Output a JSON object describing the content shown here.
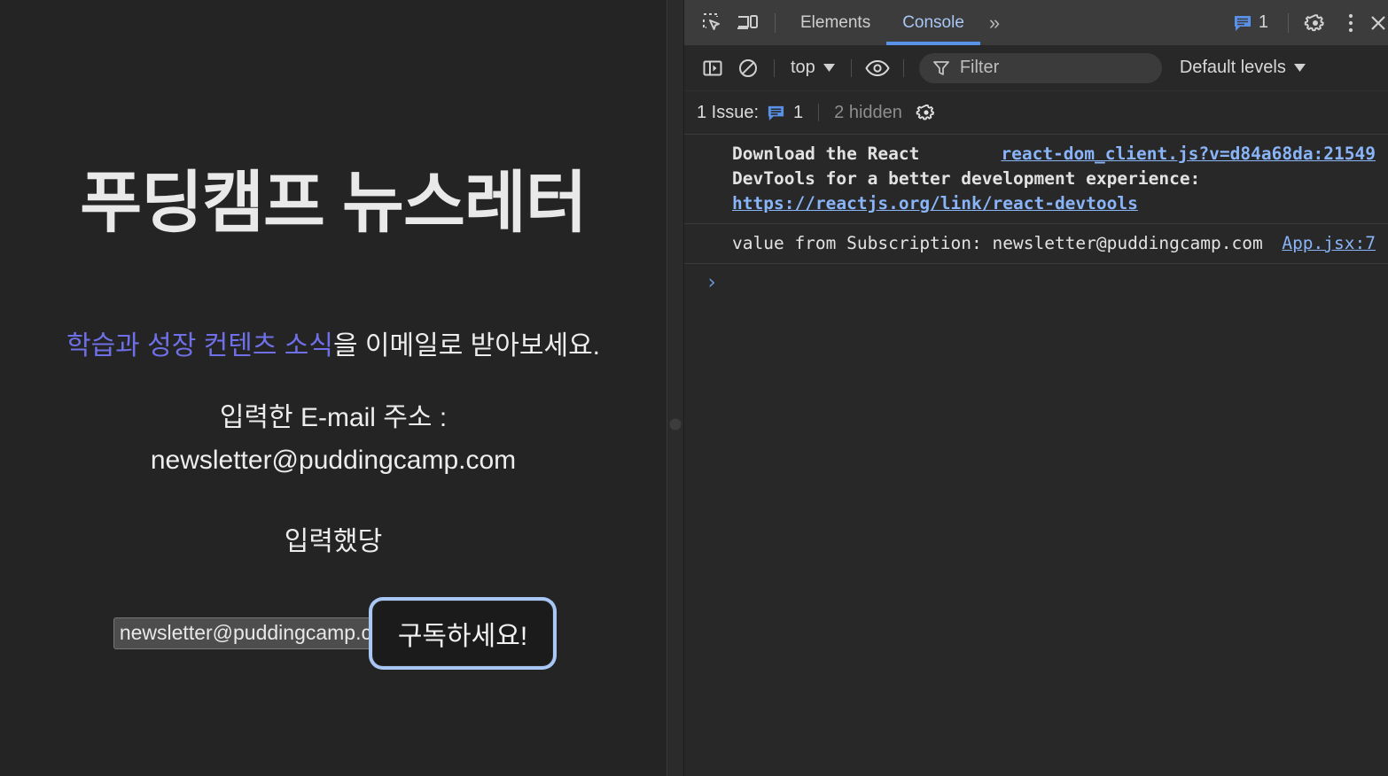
{
  "page": {
    "title": "푸딩캠프 뉴스레터",
    "tagline_highlight": "학습과 성장 컨텐츠 소식",
    "tagline_rest": "을 이메일로 받아보세요.",
    "entered_label": "입력한 E-mail 주소 :",
    "entered_value": "newsletter@puddingcamp.com",
    "typed_status": "입력했당",
    "email_input_value": "newsletter@puddingcamp.com",
    "subscribe_label": "구독하세요!",
    "accent_color": "#6f6fe8",
    "focus_ring_color": "#a8c7f5",
    "background_color": "#242424"
  },
  "devtools": {
    "tabbar": {
      "inspect_icon": "inspect-element-icon",
      "device_icon": "device-toolbar-icon",
      "tabs": [
        {
          "label": "Elements",
          "active": false
        },
        {
          "label": "Console",
          "active": true
        }
      ],
      "more_tabs_glyph": "»",
      "issues_badge_count": "1",
      "settings_icon": "gear-icon",
      "kebab_icon": "more-options-icon",
      "close_icon": "close-icon"
    },
    "filterbar": {
      "sidebar_toggle_icon": "console-sidebar-icon",
      "clear_icon": "clear-console-icon",
      "context": "top",
      "eye_icon": "live-expression-icon",
      "filter_placeholder": "Filter",
      "levels": "Default levels"
    },
    "issues_strip": {
      "label": "1 Issue:",
      "count": "1",
      "hidden": "2 hidden",
      "settings_icon": "issues-settings-gear-icon"
    },
    "console": {
      "messages": [
        {
          "source": "react-dom_client.js?v=d84a68da:21549",
          "text_before": "Download the React DevTools for a better development experience: ",
          "link": "https://reactjs.org/link/react-devtools",
          "bold": true
        },
        {
          "source": "App.jsx:7",
          "text_before": "value from Subscription: newsletter@puddingcamp.com",
          "link": "",
          "bold": false
        }
      ],
      "prompt_glyph": "›"
    }
  }
}
